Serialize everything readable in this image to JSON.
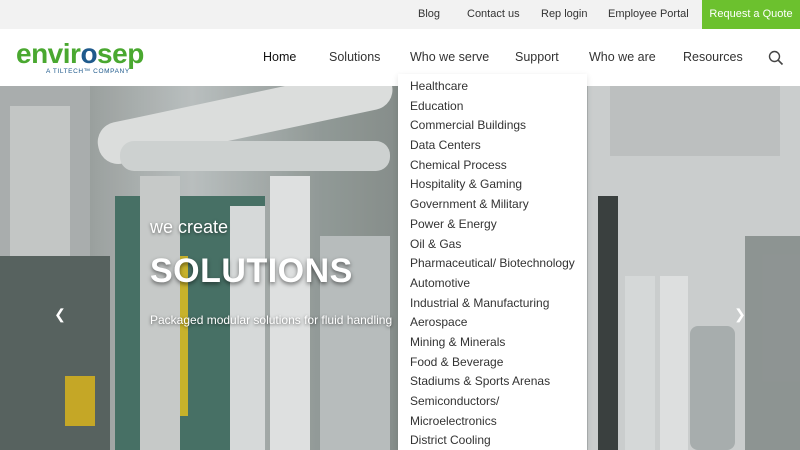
{
  "topbar": {
    "links": [
      "Blog",
      "Contact us",
      "Rep login",
      "Employee Portal"
    ],
    "quote_button": "Request a Quote"
  },
  "header": {
    "logo": {
      "word_a": "envir",
      "word_b": "o",
      "word_c": "sep",
      "tagline": "A TILTECH™ COMPANY"
    },
    "nav": [
      "Home",
      "Solutions",
      "Who we serve",
      "Support",
      "Who we are",
      "Resources"
    ],
    "active_nav": "Home"
  },
  "hero": {
    "small": "we create",
    "big": "SOLUTIONS",
    "tagline": "Packaged modular solutions for fluid handling",
    "prev_icon": "chevron-left-icon",
    "next_icon": "chevron-right-icon"
  },
  "dropdown": {
    "items": [
      "Healthcare",
      "Education",
      "Commercial Buildings",
      "Data Centers",
      "Chemical Process",
      "Hospitality & Gaming",
      "Government & Military",
      "Power & Energy",
      "Oil & Gas",
      "Pharmaceutical/ Biotechnology",
      "Automotive",
      "Industrial & Manufacturing",
      "Aerospace",
      "Mining & Minerals",
      "Food & Beverage",
      "Stadiums & Sports Arenas",
      "Semiconductors/",
      "Microelectronics",
      "District Cooling"
    ]
  },
  "colors": {
    "accent_green": "#6cc12e",
    "logo_blue": "#1f5a8c",
    "logo_green": "#4aa830"
  }
}
